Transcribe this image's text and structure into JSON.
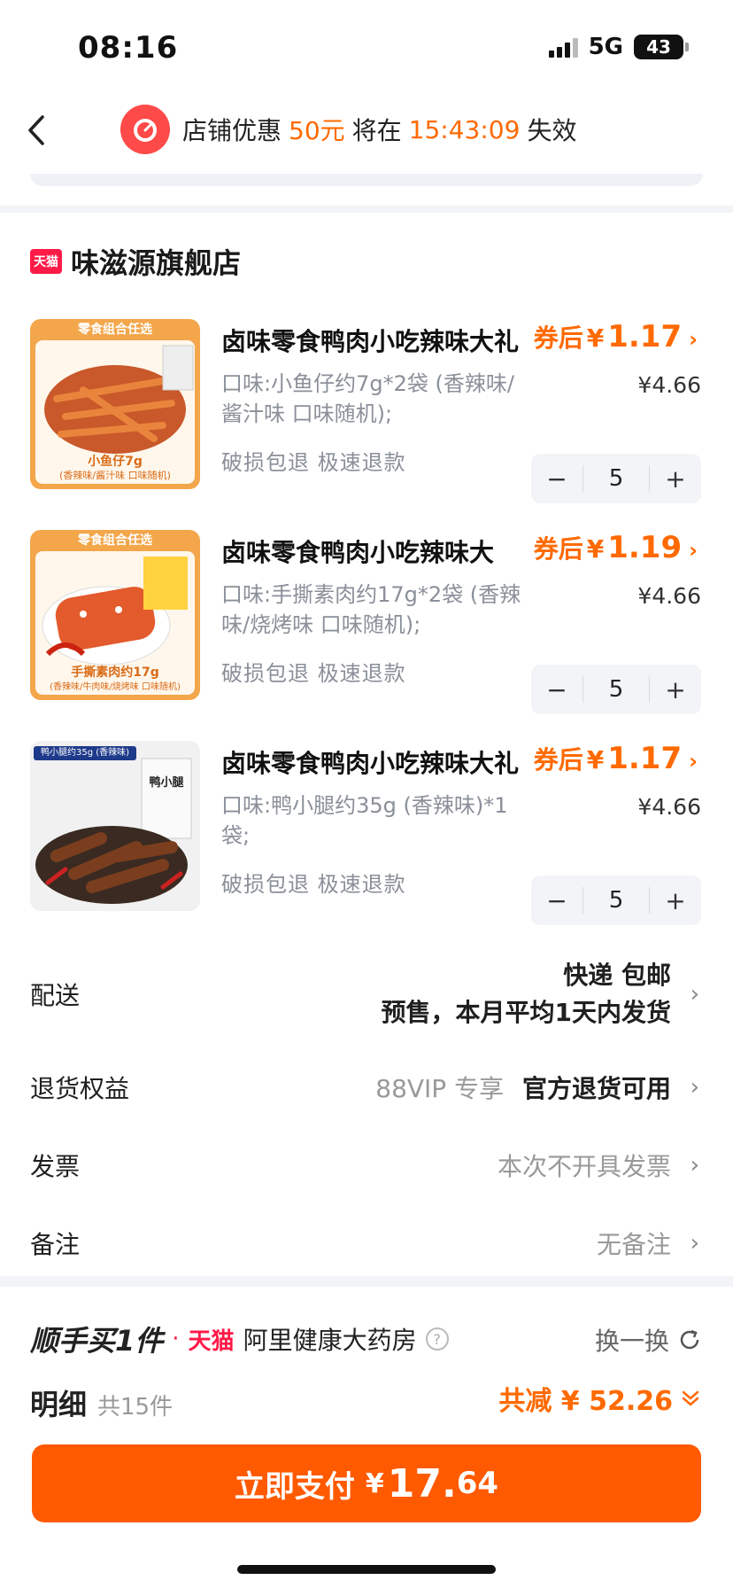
{
  "status": {
    "time": "08:16",
    "network": "5G",
    "battery": "43"
  },
  "promo": {
    "prefix": "店铺优惠",
    "amount": "50元",
    "middle": "将在",
    "countdown": "15:43:09",
    "suffix": "失效"
  },
  "store": {
    "badge": "天猫",
    "name": "味滋源旗舰店",
    "items": [
      {
        "title": "卤味零食鸭肉小吃辣味大礼",
        "coupon_label": "券后",
        "coupon_currency": "¥",
        "coupon_price": "1.17",
        "original_price": "¥4.66",
        "spec": "口味:小鱼仔约7g*2袋 (香辣味/酱汁味 口味随机);",
        "service": "破损包退 极速退款",
        "quantity": "5",
        "thumb_top": "零食组合任选",
        "thumb_name": "小鱼仔7g",
        "thumb_note": "(香辣味/酱汁味 口味随机)"
      },
      {
        "title": "卤味零食鸭肉小吃辣味大",
        "coupon_label": "券后",
        "coupon_currency": "¥",
        "coupon_price": "1.19",
        "original_price": "¥4.66",
        "spec": "口味:手撕素肉约17g*2袋 (香辣味/烧烤味 口味随机);",
        "service": "破损包退 极速退款",
        "quantity": "5",
        "thumb_top": "零食组合任选",
        "thumb_name": "手撕素肉约17g",
        "thumb_note": "(香辣味/牛肉味/烧烤味 口味随机)"
      },
      {
        "title": "卤味零食鸭肉小吃辣味大礼",
        "coupon_label": "券后",
        "coupon_currency": "¥",
        "coupon_price": "1.17",
        "original_price": "¥4.66",
        "spec": "口味:鸭小腿约35g (香辣味)*1袋;",
        "service": "破损包退 极速退款",
        "quantity": "5",
        "thumb_top": "鸭小腿约35g (香辣味)",
        "thumb_name": "鸭小腿",
        "thumb_note": ""
      }
    ],
    "delivery": {
      "label": "配送",
      "line1": "快递 包邮",
      "line2": "预售，本月平均1天内发货"
    },
    "returns": {
      "label": "退货权益",
      "vip": "88VIP 专享",
      "value": "官方退货可用"
    },
    "invoice": {
      "label": "发票",
      "value": "本次不开具发票"
    },
    "remark": {
      "label": "备注",
      "value": "无备注"
    }
  },
  "addon": {
    "title": "顺手买1件",
    "dot": "·",
    "tmall": "天猫",
    "shop": "阿里健康大药房",
    "help": "?",
    "swap": "换一换"
  },
  "detail": {
    "title": "明细",
    "count": "共15件",
    "reduce": "共减 ¥ 52.26"
  },
  "pay": {
    "label": "立即支付",
    "currency": "¥",
    "integer": "17.",
    "decimal": "64"
  },
  "colors": {
    "accent": "#ff6a00",
    "pay_button": "#ff5a00",
    "tmall_red": "#ff1a47"
  }
}
